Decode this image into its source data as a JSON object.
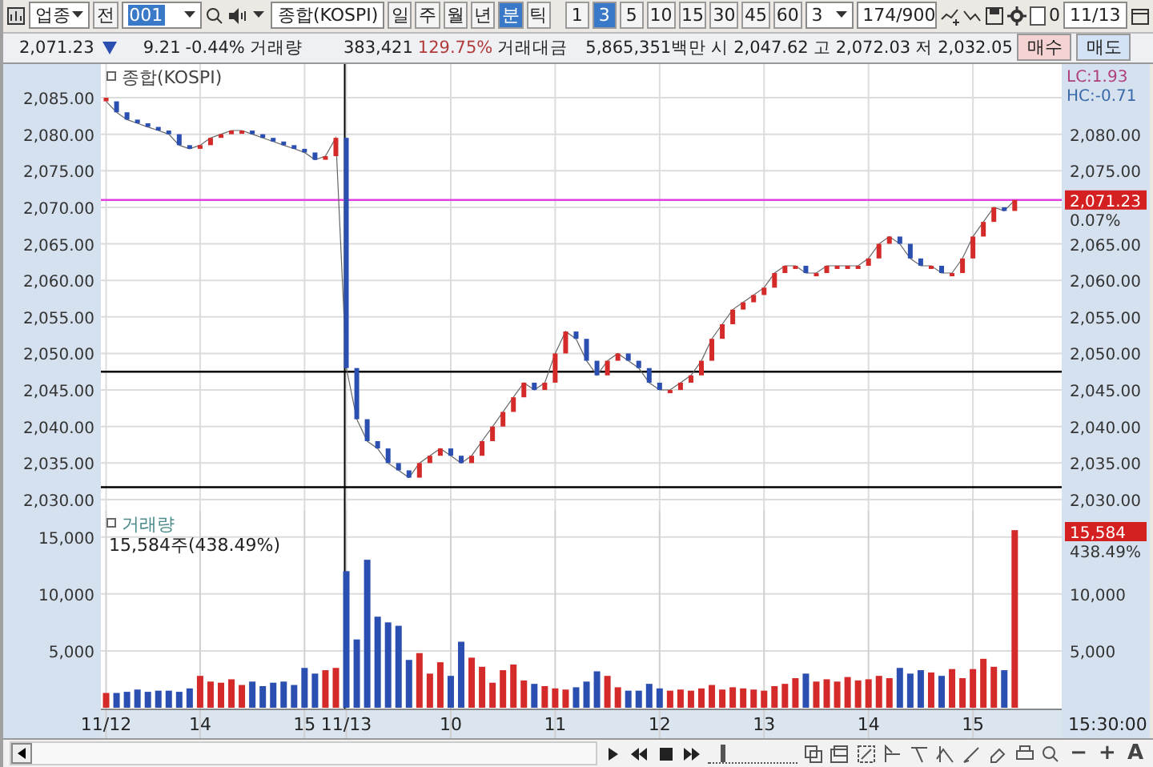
{
  "toolbar": {
    "market_select": "업종",
    "prev_button": "전",
    "code_field": "001",
    "name_field": "종합(KOSPI)",
    "period_tabs": [
      {
        "label": "일",
        "selected": false
      },
      {
        "label": "주",
        "selected": false
      },
      {
        "label": "월",
        "selected": false
      },
      {
        "label": "년",
        "selected": false
      },
      {
        "label": "분",
        "selected": true
      },
      {
        "label": "틱",
        "selected": false
      }
    ],
    "interval_tabs": [
      {
        "label": "1",
        "selected": false
      },
      {
        "label": "3",
        "selected": true
      },
      {
        "label": "5",
        "selected": false
      },
      {
        "label": "10",
        "selected": false
      },
      {
        "label": "15",
        "selected": false
      },
      {
        "label": "30",
        "selected": false
      },
      {
        "label": "45",
        "selected": false
      },
      {
        "label": "60",
        "selected": false
      }
    ],
    "count_select": "3",
    "range_field": "174/900",
    "checkbox": {
      "label": "0",
      "checked": false
    },
    "date_field": "11/13"
  },
  "quote_bar": {
    "price": "2,071.23",
    "change": "9.21",
    "change_pct": "-0.44%",
    "volume_label": "거래량",
    "volume": "383,421",
    "volume_ratio": "129.75%",
    "amount_label": "거래대금",
    "amount": "5,865,351백만",
    "open_label": "시",
    "open": "2,047.62",
    "high_label": "고",
    "high": "2,072.03",
    "low_label": "저",
    "low": "2,032.05",
    "buy_button": "매수",
    "sell_button": "매도"
  },
  "price_panel": {
    "lc": "LC:1.93",
    "hc": "HC:-0.71",
    "current_tag": "2,071.23",
    "current_pct": "0.07%",
    "right_ticks": [
      "2,080.00",
      "2,075.00",
      "2,065.00",
      "2,060.00",
      "2,055.00",
      "2,050.00",
      "2,045.00",
      "2,040.00",
      "2,035.00",
      "2,030.00"
    ],
    "chart_data": {
      "type": "line",
      "grid": true,
      "ylim": [
        2030,
        2085
      ],
      "yticks": [
        {
          "value": 2085,
          "label": "2,085.00"
        },
        {
          "value": 2080,
          "label": "2,080.00"
        },
        {
          "value": 2075,
          "label": "2,075.00"
        },
        {
          "value": 2070,
          "label": "2,070.00"
        },
        {
          "value": 2065,
          "label": "2,065.00"
        },
        {
          "value": 2060,
          "label": "2,060.00"
        },
        {
          "value": 2055,
          "label": "2,055.00"
        },
        {
          "value": 2050,
          "label": "2,050.00"
        },
        {
          "value": 2045,
          "label": "2,045.00"
        },
        {
          "value": 2040,
          "label": "2,040.00"
        },
        {
          "value": 2035,
          "label": "2,035.00"
        },
        {
          "value": 2030,
          "label": "2,030.00"
        }
      ],
      "series": [
        {
          "name": "종합(KOSPI)",
          "values": [
            2084.5,
            2083,
            2082,
            2081.5,
            2081,
            2080.5,
            2080,
            2078.5,
            2078,
            2078.5,
            2079.5,
            2080,
            2080.5,
            2080.5,
            2080,
            2079.5,
            2079,
            2078.5,
            2078,
            2077.5,
            2076.5,
            2077,
            2079.5,
            2048,
            2041,
            2038,
            2037,
            2035,
            2034,
            2033,
            2035,
            2036,
            2037,
            2036,
            2035,
            2036,
            2038,
            2040,
            2042,
            2044,
            2046,
            2045,
            2046,
            2050,
            2053,
            2052,
            2049,
            2047,
            2049,
            2050,
            2049,
            2048,
            2046,
            2045,
            2045,
            2046,
            2047,
            2049,
            2052,
            2054,
            2056,
            2057,
            2058,
            2059,
            2061,
            2062,
            2062,
            2061,
            2061,
            2062,
            2062,
            2062,
            2062,
            2063,
            2065,
            2066,
            2065,
            2063,
            2062,
            2062,
            2061,
            2061,
            2063,
            2066,
            2068,
            2070,
            2069.5,
            2071
          ]
        }
      ],
      "ref_lines": [
        {
          "axis": "y",
          "value": 2071,
          "color": "#e040e0"
        },
        {
          "axis": "y",
          "value": 2047.5,
          "color": "#000000"
        },
        {
          "axis": "y",
          "value": 2031.7,
          "color": "#000000"
        }
      ]
    }
  },
  "volume_panel": {
    "reading": "15,584주(438.49%)",
    "current_tag": "15,584",
    "current_pct": "438.49%",
    "right_ticks": [
      "10,000",
      "5,000"
    ],
    "end_time": "15:30:00",
    "chart_data": {
      "type": "bar",
      "grid": true,
      "ylim": [
        0,
        17300
      ],
      "ref_lines": [
        {
          "axis": "x",
          "value": "11/13",
          "color": "#000000"
        }
      ],
      "categories": [
        "11/12",
        null,
        null,
        null,
        null,
        null,
        null,
        null,
        null,
        "14",
        null,
        null,
        null,
        null,
        null,
        null,
        null,
        null,
        null,
        "15",
        null,
        null,
        null,
        "11/13",
        null,
        null,
        null,
        null,
        null,
        null,
        null,
        null,
        null,
        "10",
        null,
        null,
        null,
        null,
        null,
        null,
        null,
        null,
        null,
        "11",
        null,
        null,
        null,
        null,
        null,
        null,
        null,
        null,
        null,
        "12",
        null,
        null,
        null,
        null,
        null,
        null,
        null,
        null,
        null,
        "13",
        null,
        null,
        null,
        null,
        null,
        null,
        null,
        null,
        null,
        "14",
        null,
        null,
        null,
        null,
        null,
        null,
        null,
        null,
        null,
        "15",
        null,
        null,
        null,
        null,
        null,
        null,
        null,
        null
      ],
      "yticks": [
        {
          "value": 15000,
          "label": "15,000"
        },
        {
          "value": 10000,
          "label": "10,000"
        },
        {
          "value": 5000,
          "label": "5,000"
        }
      ],
      "series": [
        {
          "name": "거래량",
          "values": [
            1300,
            1300,
            1400,
            1600,
            1400,
            1500,
            1500,
            1400,
            1700,
            2800,
            2300,
            2200,
            2500,
            2000,
            2300,
            1900,
            2200,
            2300,
            2000,
            3500,
            3000,
            3300,
            3500,
            12000,
            6000,
            13000,
            8000,
            7500,
            7200,
            4200,
            4800,
            3000,
            4000,
            2800,
            5800,
            4400,
            3600,
            2200,
            3300,
            3800,
            2400,
            2100,
            1900,
            1700,
            1600,
            1800,
            2300,
            3200,
            2800,
            1800,
            1500,
            1500,
            2100,
            1700,
            1500,
            1600,
            1500,
            1700,
            2000,
            1600,
            1800,
            1700,
            1600,
            1500,
            1900,
            2100,
            2600,
            3000,
            2300,
            2500,
            2300,
            2700,
            2400,
            2500,
            2800,
            2600,
            3500,
            3000,
            3300,
            3100,
            2800,
            3400,
            2600,
            3400,
            4300,
            3600,
            3300,
            15600,
            null,
            null,
            null,
            null
          ]
        }
      ]
    }
  },
  "bottom_bar": {
    "slider": {
      "level": 0.15
    },
    "zoom_out": "−",
    "zoom_in": "+",
    "font_button": "A"
  }
}
